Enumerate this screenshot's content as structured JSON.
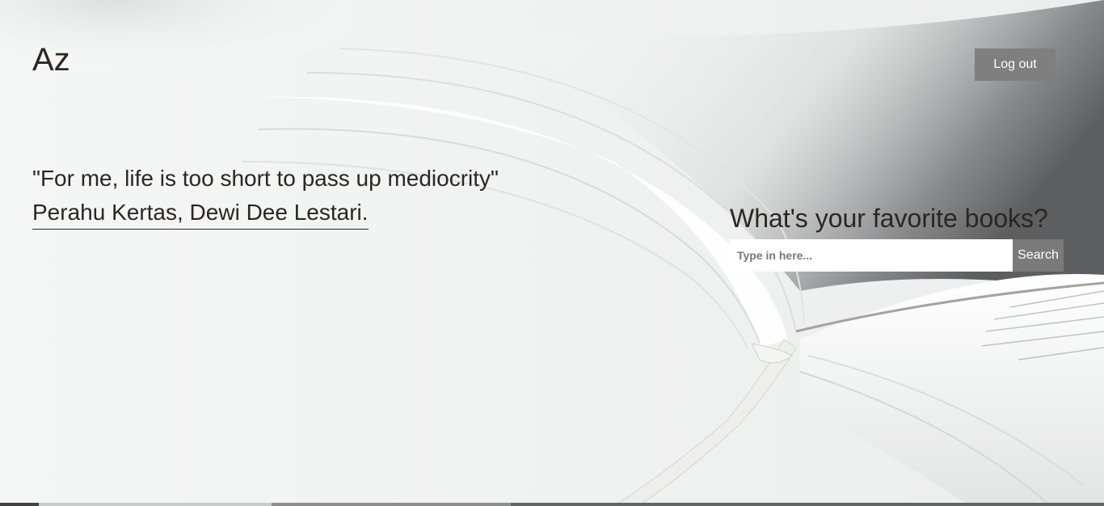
{
  "header": {
    "logo_text": "Az",
    "logout_label": "Log out"
  },
  "quote": {
    "text": "\"For me, life is too short to pass up mediocrity\"",
    "source": "Perahu Kertas, Dewi Dee Lestari."
  },
  "search": {
    "heading": "What's your favorite books?",
    "placeholder": "Type in here...",
    "value": "",
    "button_label": "Search"
  },
  "colors": {
    "text": "#2b2622",
    "button_bg": "#7f7f7f",
    "button_text": "#ffffff",
    "background": "#f4f5f5"
  },
  "background_image": {
    "subject": "open-book-photo"
  }
}
